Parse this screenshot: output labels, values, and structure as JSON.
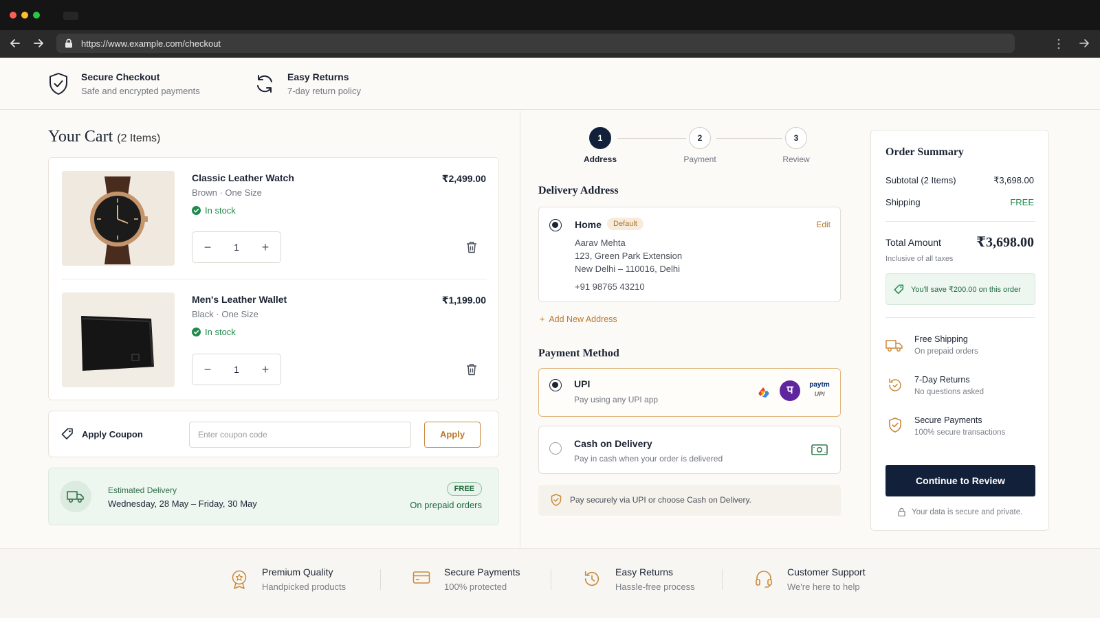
{
  "browser": {
    "url": "https://www.example.com/checkout"
  },
  "trust": [
    {
      "title": "Secure Checkout",
      "sub": "Safe and encrypted payments",
      "icon": "shield-check-icon"
    },
    {
      "title": "Easy Returns",
      "sub": "7-day return policy",
      "icon": "refresh-icon"
    }
  ],
  "cart": {
    "title": "Your Cart",
    "count": "(2 Items)",
    "items": [
      {
        "name": "Classic Leather Watch",
        "variant": "Brown · One Size",
        "stock": "In stock",
        "price": "₹2,499.00",
        "qty": "1"
      },
      {
        "name": "Men's Leather Wallet",
        "variant": "Black · One Size",
        "stock": "In stock",
        "price": "₹1,199.00",
        "qty": "1"
      }
    ]
  },
  "coupon": {
    "label": "Apply Coupon",
    "placeholder": "Enter coupon code",
    "button": "Apply"
  },
  "delivery": {
    "label": "Estimated Delivery",
    "dates": "Wednesday, 28 May – Friday, 30 May",
    "badge": "FREE",
    "note": "On prepaid orders"
  },
  "steps": [
    {
      "num": "1",
      "label": "Address",
      "active": true
    },
    {
      "num": "2",
      "label": "Payment",
      "active": false
    },
    {
      "num": "3",
      "label": "Review",
      "active": false
    }
  ],
  "address": {
    "section_title": "Delivery Address",
    "type": "Home",
    "badge": "Default",
    "edit": "Edit",
    "name": "Aarav Mehta",
    "line1": "123, Green Park Extension",
    "line2": "New Delhi – 110016, Delhi",
    "phone": "+91 98765 43210",
    "add_new": "Add New Address"
  },
  "payment": {
    "section_title": "Payment Method",
    "upi_title": "UPI",
    "upi_sub": "Pay using any UPI app",
    "paytm_text": "paytm",
    "upi_logo_text": "UPI",
    "cod_title": "Cash on Delivery",
    "cod_sub": "Pay in cash when your order is delivered",
    "note": "Pay securely via UPI or choose Cash on Delivery.",
    "selected": "UPI"
  },
  "summary": {
    "title": "Order Summary",
    "subtotal_label": "Subtotal (2 Items)",
    "subtotal_value": "₹3,698.00",
    "shipping_label": "Shipping",
    "shipping_value": "FREE",
    "total_label": "Total Amount",
    "total_value": "₹3,698.00",
    "tax_note": "Inclusive of all taxes",
    "savings": "You'll save ₹200.00 on this order",
    "perks": [
      {
        "title": "Free Shipping",
        "sub": "On prepaid orders",
        "icon": "truck-icon"
      },
      {
        "title": "7-Day Returns",
        "sub": "No questions asked",
        "icon": "return-icon"
      },
      {
        "title": "Secure Payments",
        "sub": "100% secure transactions",
        "icon": "shield-check-icon"
      }
    ],
    "cta": "Continue to Review",
    "secure_note": "Your data is secure and private."
  },
  "footer": [
    {
      "title": "Premium Quality",
      "sub": "Handpicked products",
      "icon": "badge-icon"
    },
    {
      "title": "Secure Payments",
      "sub": "100% protected",
      "icon": "card-icon"
    },
    {
      "title": "Easy Returns",
      "sub": "Hassle-free process",
      "icon": "return-icon"
    },
    {
      "title": "Customer Support",
      "sub": "We're here to help",
      "icon": "headset-icon"
    }
  ],
  "colors": {
    "accent": "#c9893a",
    "primary": "#12203a",
    "success": "#1f8a4c",
    "upi_border": "#e0b57c"
  }
}
